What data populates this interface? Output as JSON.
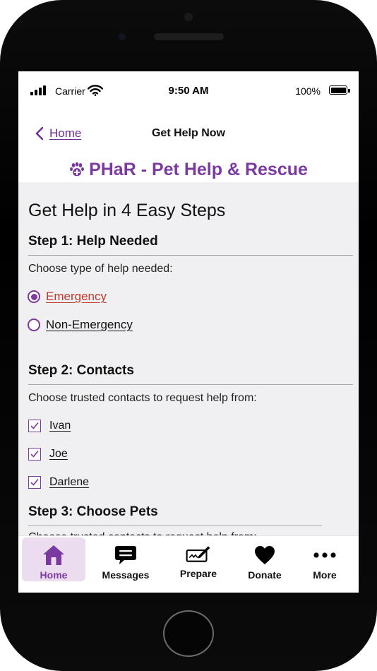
{
  "status_bar": {
    "carrier": "Carrier",
    "time": "9:50 AM",
    "battery": "100%"
  },
  "nav": {
    "back_label": "Home",
    "title": "Get Help Now"
  },
  "brand": {
    "title": "PHaR - Pet Help & Rescue",
    "icon": "paw-icon"
  },
  "main": {
    "heading": "Get Help in 4 Easy Steps",
    "step1": {
      "title": "Step 1:  Help Needed",
      "prompt": "Choose type of help needed:",
      "options": [
        {
          "label": "Emergency",
          "checked": true
        },
        {
          "label": "Non-Emergency",
          "checked": false
        }
      ]
    },
    "step2": {
      "title": "Step 2:  Contacts",
      "prompt": "Choose trusted contacts to request help from:",
      "contacts": [
        {
          "label": "Ivan",
          "checked": true
        },
        {
          "label": "Joe",
          "checked": true
        },
        {
          "label": "Darlene",
          "checked": true
        }
      ]
    },
    "step3": {
      "title": "Step 3:  Choose Pets",
      "prompt": "Choose trusted contacts to request help from:"
    }
  },
  "tab_bar": {
    "tabs": [
      {
        "label": "Home",
        "icon": "home-icon",
        "active": true
      },
      {
        "label": "Messages",
        "icon": "messages-icon",
        "active": false
      },
      {
        "label": "Prepare",
        "icon": "prepare-icon",
        "active": false
      },
      {
        "label": "Donate",
        "icon": "heart-icon",
        "active": false
      },
      {
        "label": "More",
        "icon": "more-icon",
        "active": false
      }
    ]
  },
  "colors": {
    "brand_purple": "#7b3a9f",
    "emergency_red": "#c0392b",
    "content_bg": "#f0eff1",
    "active_tab_bg": "#ecdcef"
  }
}
